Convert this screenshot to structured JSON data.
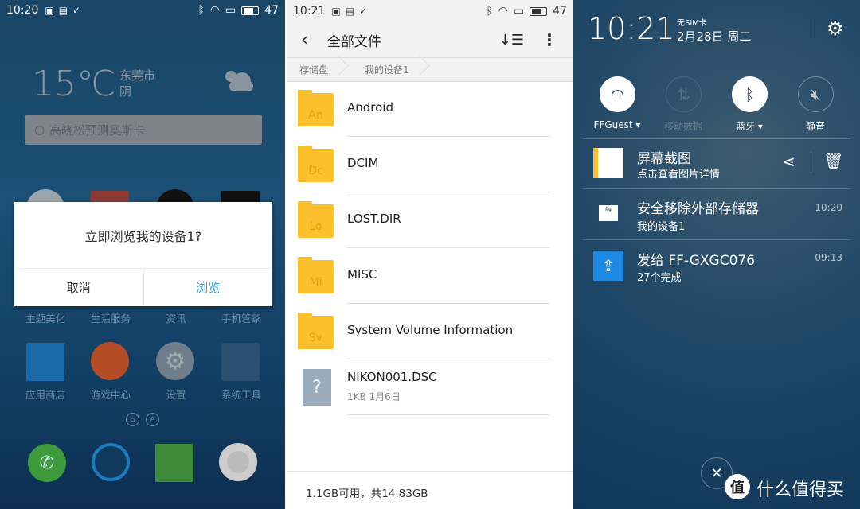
{
  "left": {
    "status": {
      "time": "10:20",
      "battery": "47"
    },
    "weather": {
      "temp": "15℃",
      "city": "东莞市",
      "condition": "阴"
    },
    "search": {
      "placeholder": "高晓松预测奥斯卡"
    },
    "apps_row1": [
      "主题美化",
      "生活服务",
      "资讯",
      "手机管家"
    ],
    "apps_row2": [
      "应用商店",
      "游戏中心",
      "设置",
      "系统工具"
    ],
    "dialog": {
      "question": "立即浏览我的设备1?",
      "cancel": "取消",
      "confirm": "浏览"
    },
    "page_dots": [
      "⌂",
      "A"
    ]
  },
  "middle": {
    "status": {
      "time": "10:21",
      "battery": "47"
    },
    "title": "全部文件",
    "breadcrumb": [
      "存储盘",
      "我的设备1"
    ],
    "files": [
      {
        "abbr": "An",
        "name": "Android"
      },
      {
        "abbr": "Dc",
        "name": "DCIM"
      },
      {
        "abbr": "Lo",
        "name": "LOST.DIR"
      },
      {
        "abbr": "Mi",
        "name": "MISC"
      },
      {
        "abbr": "Sv",
        "name": "System Volume Information"
      },
      {
        "name": "NIKON001.DSC",
        "meta": "1KB  1月6日"
      }
    ],
    "storage": "1.1GB可用，共14.83GB"
  },
  "right": {
    "time": "10:21",
    "sim": "无SIM卡",
    "date": "2月28日 周二",
    "toggles": [
      {
        "label": "FFGuest ▾",
        "on": true
      },
      {
        "label": "移动数据",
        "on": false
      },
      {
        "label": "蓝牙 ▾",
        "on": true
      },
      {
        "label": "静音",
        "on": false
      }
    ],
    "notifications": [
      {
        "title": "屏幕截图",
        "sub": "点击查看图片详情"
      },
      {
        "title": "安全移除外部存储器",
        "sub": "我的设备1",
        "time": "10:20"
      },
      {
        "title": "发给  FF-GXGC076",
        "sub": "27个完成",
        "time": "09:13"
      }
    ],
    "watermark": "什么值得买",
    "watermark_badge": "值"
  },
  "colors": {
    "accent_blue": "#34a6e8",
    "folder": "#fcc02d"
  }
}
